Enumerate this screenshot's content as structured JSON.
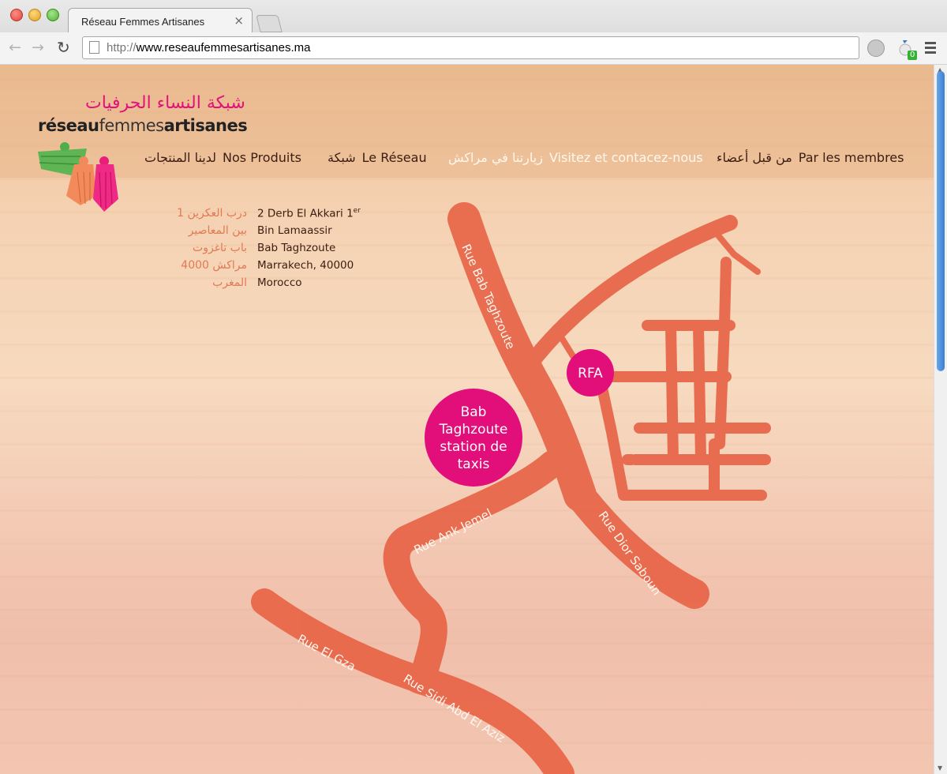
{
  "browser": {
    "tab_title": "Réseau Femmes Artisanes",
    "tab_close": "×",
    "url_protocol": "http://",
    "url_host": "www.reseaufemmesartisanes.ma",
    "extension_badge": "0"
  },
  "logo": {
    "arabic": "شبكة النساء الحرفيات",
    "word1": "réseau",
    "word2": "femmes",
    "word3": "artisanes"
  },
  "nav": [
    {
      "fr": "Nos Produits",
      "ar": "لدينا المنتجات"
    },
    {
      "fr": "Le Réseau",
      "ar": "شبكة"
    },
    {
      "fr": "Visitez et contacez-nous",
      "ar": "زيارتنا في مراكش"
    },
    {
      "fr": "Par les membres",
      "ar": "من قبل أعضاء"
    }
  ],
  "address": {
    "ar": [
      "درب العكرين 1",
      "بين المعاصير",
      "باب تاغزوت",
      "مراكش 4000",
      "المغرب"
    ],
    "fr": [
      "2 Derb El Akkari 1",
      "Bin Lamaassir",
      "Bab Taghzoute",
      "Marrakech, 40000",
      "Morocco"
    ],
    "fr_sup": "er"
  },
  "map": {
    "streets": {
      "bab_taghzoute": "Rue Bab Taghzoute",
      "ank_jemel": "Rue Ank Jemel",
      "dior_saboun": "Rue Dior Saboun",
      "el_gza": "Rue El Gza",
      "sidi_abd_el_aziz": "Rue Sidi Abd El Aziz"
    },
    "markers": {
      "rfa": "RFA",
      "station": [
        "Bab",
        "Taghzoute",
        "station de",
        "taxis"
      ]
    },
    "colors": {
      "road": "#e8674a",
      "marker": "#e20f7a"
    }
  }
}
